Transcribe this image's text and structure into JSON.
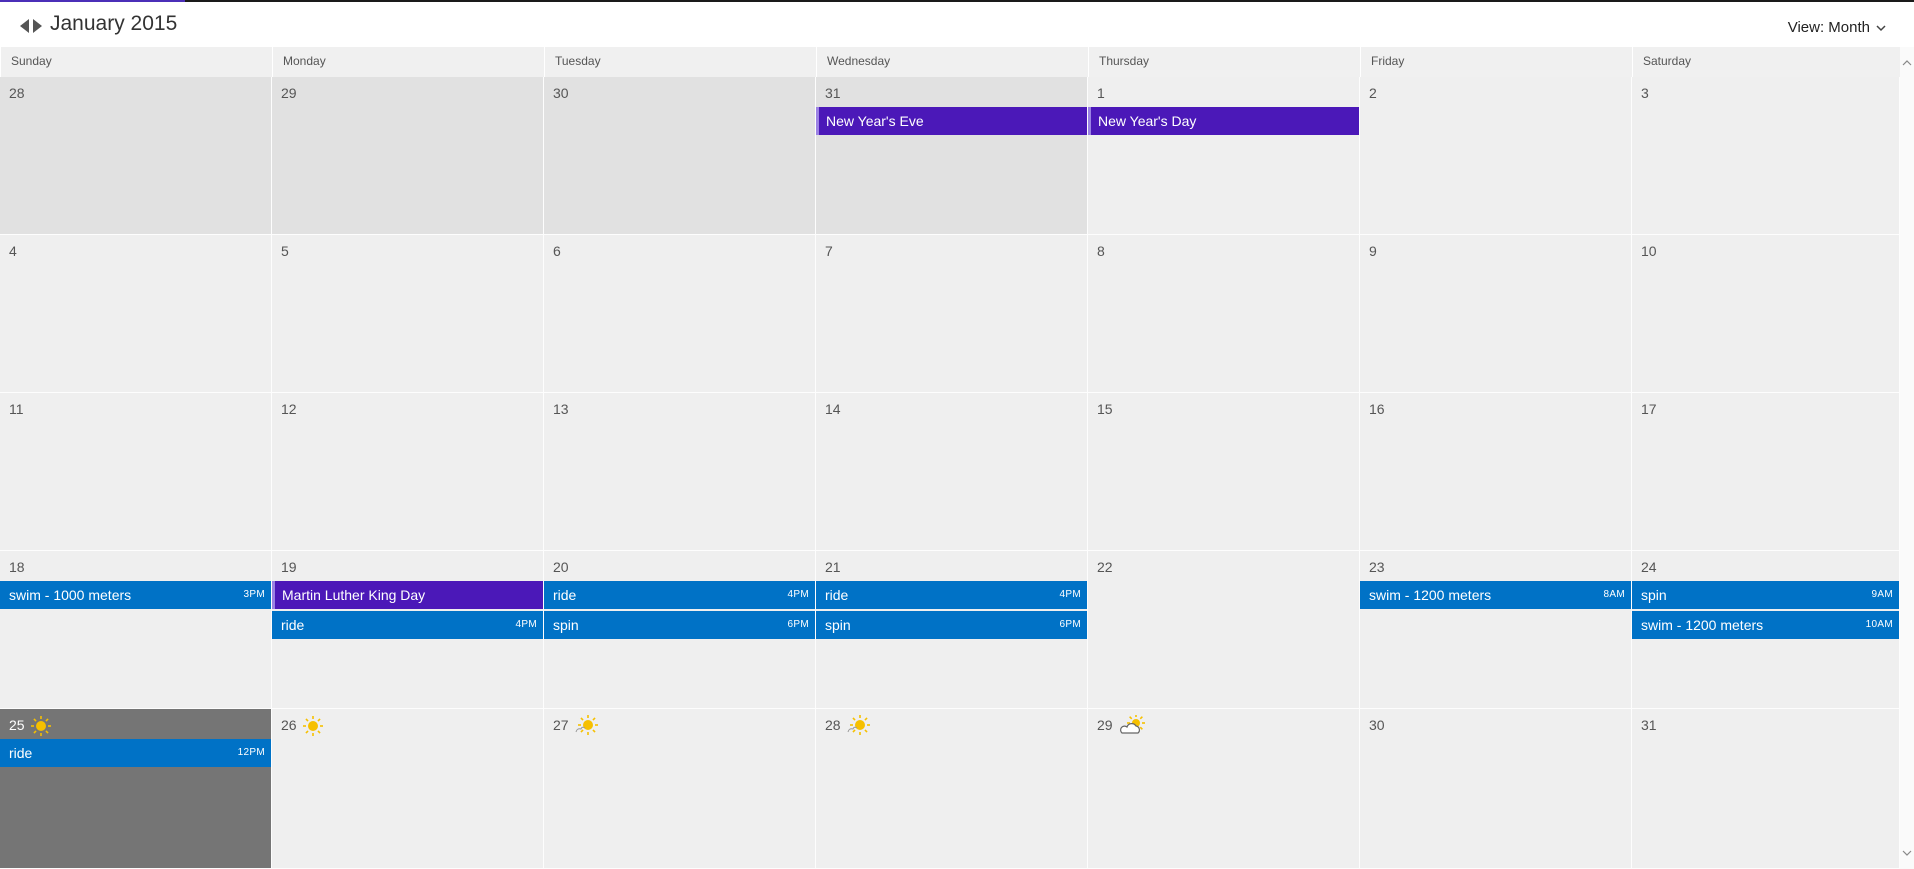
{
  "header": {
    "title": "January 2015",
    "view_label": "View: Month",
    "icons": {
      "prev": "triangle-left-icon",
      "next": "triangle-right-icon",
      "view_dropdown": "chevron-down-icon"
    }
  },
  "colors": {
    "event_blue": "#0072c6",
    "holiday_purple": "#4b18b8",
    "today_bg": "#757575",
    "sun_yellow": "#f6c000",
    "accent": "#4b2fb8"
  },
  "weekdays": [
    "Sunday",
    "Monday",
    "Tuesday",
    "Wednesday",
    "Thursday",
    "Friday",
    "Saturday"
  ],
  "weeks": [
    [
      {
        "day": "28",
        "other": true,
        "events": []
      },
      {
        "day": "29",
        "other": true,
        "events": []
      },
      {
        "day": "30",
        "other": true,
        "events": []
      },
      {
        "day": "31",
        "other": true,
        "events": [
          {
            "title": "New Year's Eve",
            "type": "holiday"
          }
        ]
      },
      {
        "day": "1",
        "events": [
          {
            "title": "New Year's Day",
            "type": "holiday"
          }
        ]
      },
      {
        "day": "2",
        "events": []
      },
      {
        "day": "3",
        "events": []
      }
    ],
    [
      {
        "day": "4",
        "events": []
      },
      {
        "day": "5",
        "events": []
      },
      {
        "day": "6",
        "events": []
      },
      {
        "day": "7",
        "events": []
      },
      {
        "day": "8",
        "events": []
      },
      {
        "day": "9",
        "events": []
      },
      {
        "day": "10",
        "events": []
      }
    ],
    [
      {
        "day": "11",
        "events": []
      },
      {
        "day": "12",
        "events": []
      },
      {
        "day": "13",
        "events": []
      },
      {
        "day": "14",
        "events": []
      },
      {
        "day": "15",
        "events": []
      },
      {
        "day": "16",
        "events": []
      },
      {
        "day": "17",
        "events": []
      }
    ],
    [
      {
        "day": "18",
        "events": [
          {
            "title": "swim - 1000 meters",
            "time": "3PM",
            "type": "event"
          }
        ]
      },
      {
        "day": "19",
        "events": [
          {
            "title": "Martin Luther King Day",
            "type": "holiday"
          },
          {
            "title": "ride",
            "time": "4PM",
            "type": "event"
          }
        ]
      },
      {
        "day": "20",
        "events": [
          {
            "title": "ride",
            "time": "4PM",
            "type": "event"
          },
          {
            "title": "spin",
            "time": "6PM",
            "type": "event"
          }
        ]
      },
      {
        "day": "21",
        "events": [
          {
            "title": "ride",
            "time": "4PM",
            "type": "event"
          },
          {
            "title": "spin",
            "time": "6PM",
            "type": "event"
          }
        ]
      },
      {
        "day": "22",
        "events": []
      },
      {
        "day": "23",
        "events": [
          {
            "title": "swim - 1200 meters",
            "time": "8AM",
            "type": "event"
          }
        ]
      },
      {
        "day": "24",
        "events": [
          {
            "title": "spin",
            "time": "9AM",
            "type": "event"
          },
          {
            "title": "swim - 1200 meters",
            "time": "10AM",
            "type": "event"
          }
        ]
      }
    ],
    [
      {
        "day": "25",
        "today": true,
        "weather": "sunny-icon",
        "events": [
          {
            "title": "ride",
            "time": "12PM",
            "type": "event"
          }
        ]
      },
      {
        "day": "26",
        "weather": "sunny-icon",
        "events": []
      },
      {
        "day": "27",
        "weather": "partly-sunny-icon",
        "events": []
      },
      {
        "day": "28",
        "weather": "partly-sunny-icon",
        "events": []
      },
      {
        "day": "29",
        "weather": "partly-cloudy-icon",
        "events": []
      },
      {
        "day": "30",
        "events": []
      },
      {
        "day": "31",
        "events": []
      }
    ]
  ]
}
